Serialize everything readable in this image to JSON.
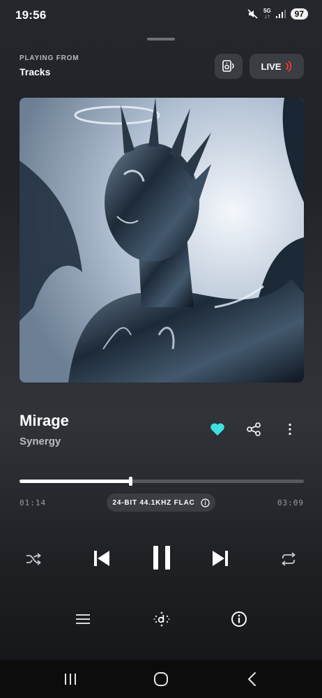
{
  "status_bar": {
    "time": "19:56",
    "network": "5G",
    "battery": "97",
    "icons": [
      "mute-icon",
      "signal-icon"
    ]
  },
  "header": {
    "playing_from_label": "PLAYING FROM",
    "source": "Tracks",
    "live_label": "LIVE"
  },
  "track": {
    "title": "Mirage",
    "artist": "Synergy",
    "liked": true
  },
  "playback": {
    "elapsed": "01:14",
    "total": "03:09",
    "progress": 0.39,
    "quality": "24-BIT 44.1KHZ FLAC"
  },
  "colors": {
    "accent": "#3fe0e0",
    "live": "#ff3b30"
  },
  "icons": {
    "controls": [
      "shuffle-icon",
      "previous-icon",
      "pause-icon",
      "next-icon",
      "repeat-icon"
    ],
    "bottom": [
      "queue-icon",
      "dolby-icon",
      "info-icon"
    ],
    "nav": [
      "recents-icon",
      "home-icon",
      "back-icon"
    ]
  }
}
